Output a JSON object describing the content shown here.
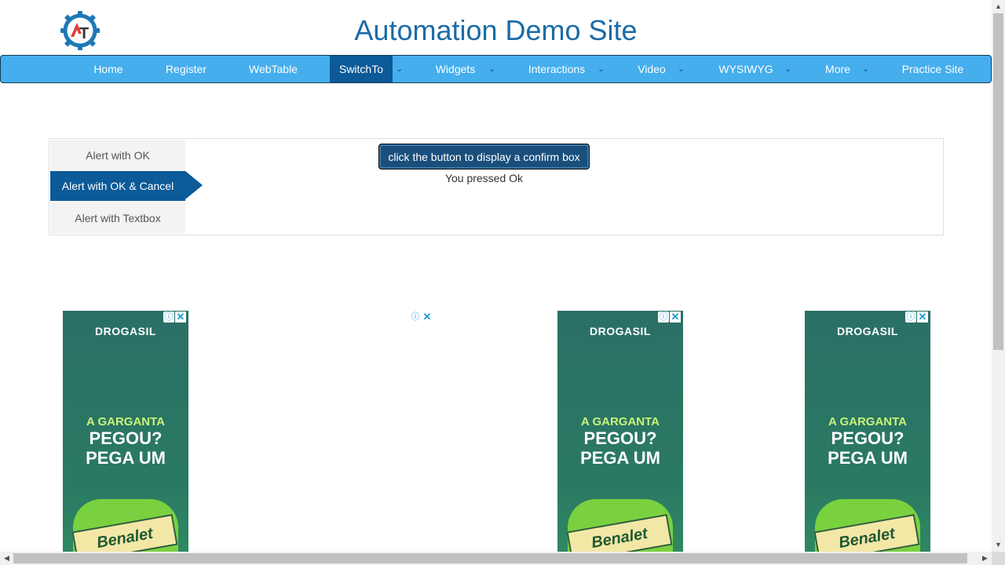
{
  "header": {
    "title": "Automation Demo Site",
    "logo_icon": "automation-testing-gear-logo"
  },
  "nav": {
    "items": [
      {
        "label": "Home"
      },
      {
        "label": "Register"
      },
      {
        "label": "WebTable"
      },
      {
        "label": "SwitchTo"
      },
      {
        "label": "Widgets"
      },
      {
        "label": "Interactions"
      },
      {
        "label": "Video"
      },
      {
        "label": "WYSIWYG"
      },
      {
        "label": "More"
      },
      {
        "label": "Practice Site"
      }
    ],
    "active": "SwitchTo",
    "caret_glyph": "⌄",
    "colors": {
      "bar": "#45aeed",
      "active": "#0c5a98"
    }
  },
  "alerts": {
    "tabs": [
      {
        "label": "Alert with OK"
      },
      {
        "label": "Alert with OK & Cancel"
      },
      {
        "label": "Alert with Textbox"
      }
    ],
    "active_tab": "Alert with OK & Cancel",
    "button_label": "click the button to display a confirm box",
    "result": "You pressed Ok"
  },
  "ads": {
    "brand": "DROGASIL",
    "line1": "A GARGANTA",
    "line2": "PEGOU?",
    "line3": "PEGA UM",
    "product": "Benalet",
    "adchoices_glyph": "ⓘ",
    "close_glyph": "✕"
  },
  "scrollbars": {
    "up": "▲",
    "down": "▼",
    "left": "◀",
    "right": "▶"
  }
}
